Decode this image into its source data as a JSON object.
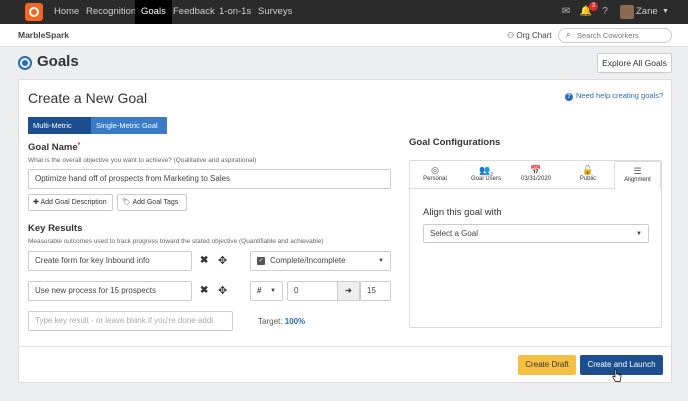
{
  "nav": {
    "items": [
      "Home",
      "Recognition",
      "Goals",
      "Feedback",
      "1-on-1s",
      "Surveys"
    ],
    "active": "Goals",
    "notification_count": "3",
    "user_name": "Zane"
  },
  "subbar": {
    "brand": "MarbleSpark",
    "org_chart": "Org Chart",
    "search_placeholder": "Search Coworkers"
  },
  "page": {
    "title": "Goals",
    "explore_button": "Explore All Goals"
  },
  "form": {
    "title": "Create a New Goal",
    "help_link": "Need help creating goals?",
    "toggle": [
      "Multi-Metric Goal",
      "Single-Metric Goal"
    ],
    "goal_name_label": "Goal Name",
    "goal_name_required": "*",
    "goal_name_hint": "What is the overall objective you want to achieve? (Qualitative and aspirational)",
    "goal_name_value": "Optimize hand off of prospects from Marketing to Sales",
    "add_description": "Add Goal Description",
    "add_tags": "Add Goal Tags",
    "key_results_label": "Key Results",
    "key_results_hint": "Measurable outcomes used to track progress toward the stated objective (Quantifiable and achievable)",
    "kr1_value": "Create form for key Inbound info",
    "kr1_type": "Complete/Incomplete",
    "kr2_value": "Use new process for 15 prospects",
    "kr2_type": "#",
    "kr2_start": "0",
    "kr2_target": "15",
    "kr_placeholder": "Type key result - or leave blank if you're done addi",
    "target_label": "Target:",
    "target_value": "100%"
  },
  "config": {
    "title": "Goal Configurations",
    "tabs": [
      "Personal",
      "Goal Users",
      "03/31/2020",
      "Public",
      "Alignment"
    ],
    "goal_users_count": "2",
    "active_tab": "Alignment",
    "align_title": "Align this goal with",
    "align_select": "Select a Goal"
  },
  "footer": {
    "draft_button": "Create Draft",
    "launch_button": "Create and Launch"
  },
  "colors": {
    "brand_orange": "#f26522",
    "primary_blue": "#1d4e8f",
    "accent_blue": "#2a6db5",
    "draft_yellow": "#f5c042"
  }
}
